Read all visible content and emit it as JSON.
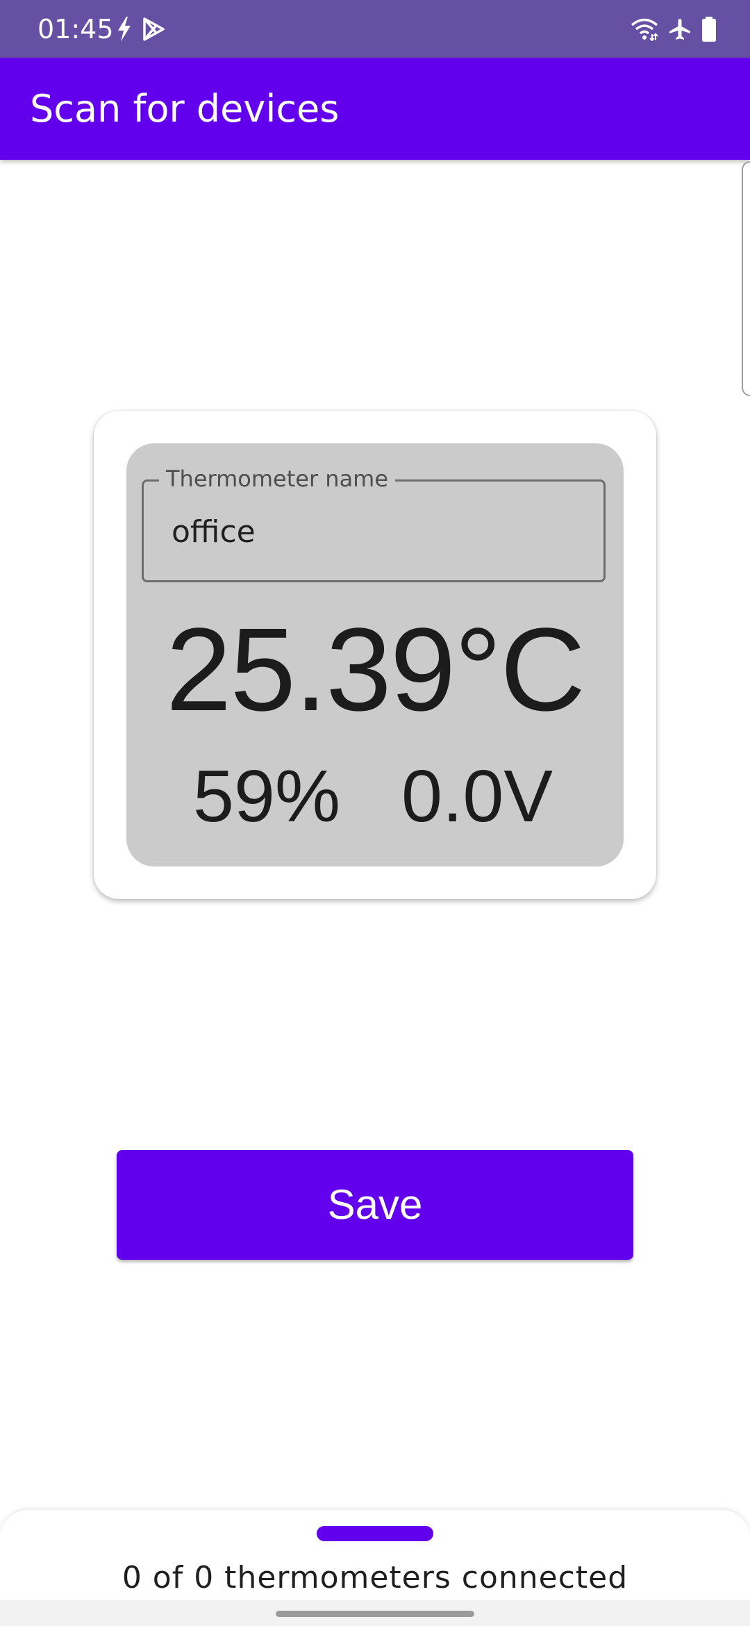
{
  "status_bar": {
    "time": "01:45",
    "left_icons": [
      "flash-icon",
      "play-store-icon"
    ],
    "right_icons": [
      "wifi-icon",
      "airplane-mode-icon",
      "battery-icon"
    ],
    "background_color": "#6650a4"
  },
  "app_bar": {
    "title": "Scan for devices",
    "background_color": "#6200ee"
  },
  "thermometer_card": {
    "name_field": {
      "label": "Thermometer name",
      "value": "office"
    },
    "temperature": "25.39°C",
    "humidity": "59%",
    "voltage": "0.0V"
  },
  "actions": {
    "save_label": "Save"
  },
  "bottom_sheet": {
    "status_text": "0 of 0 thermometers connected",
    "accent_color": "#6200ee"
  }
}
